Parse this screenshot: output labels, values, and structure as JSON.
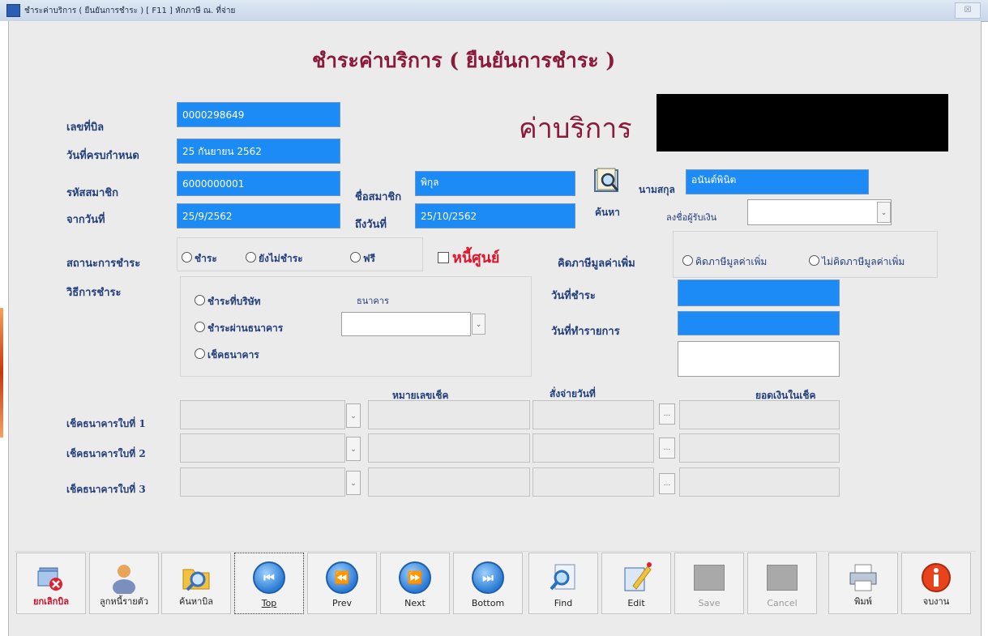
{
  "window": {
    "title": "ชำระค่าบริการ ( ยืนยันการชำระ ) [ F11 ] หักภาษี ณ. ที่จ่าย",
    "close_label": "☒"
  },
  "heading": "ชำระค่าบริการ ( ยืนยันการชำระ )",
  "service_title": "ค่าบริการ",
  "labels": {
    "bill_no": "เลขที่บิล",
    "due_date": "วันที่ครบกำหนด",
    "member_code": "รหัสสมาชิก",
    "from_date": "จากวันที่",
    "member_name": "ชื่อสมาชิก",
    "to_date": "ถึงวันที่",
    "surname": "นามสกุล",
    "search": "ค้นหา",
    "signer": "ลงชื่อผู้รับเงิน",
    "pay_status": "สถานะการชำระ",
    "vat": "คิดภาษีมูลค่าเพิ่ม",
    "pay_method": "วิธีการชำระ",
    "bank": "ธนาคาร",
    "pay_date": "วันที่ชำระ",
    "trans_date": "วันที่ทำรายการ",
    "cheque_no_header": "หมายเลขเช็ค",
    "pay_date_header": "สั่งจ่ายวันที่",
    "amount_header": "ยอดเงินในเช็ค",
    "zero_debt": "หนี้ศูนย์"
  },
  "fields": {
    "bill_no": "0000298649",
    "due_date": "25 กันยายน 2562",
    "member_code": "6000000001",
    "from_date": "25/9/2562",
    "member_name": "พิกุล",
    "to_date": "25/10/2562",
    "surname": "อนันต์พินิต"
  },
  "status_options": [
    "ชำระ",
    "ยังไม่ชำระ",
    "ฟรี"
  ],
  "vat_options": [
    "คิดภาษีมูลค่าเพิ่ม",
    "ไม่คิดภาษีมูลค่าเพิ่ม"
  ],
  "method_options": [
    "ชำระที่บริษัท",
    "ชำระผ่านธนาคาร",
    "เช็คธนาคาร"
  ],
  "cheque_rows": [
    "เช็คธนาคารใบที่ 1",
    "เช็คธนาคารใบที่ 2",
    "เช็คธนาคารใบที่ 3"
  ],
  "combo_arrow": "⌄",
  "dots": "...",
  "toolbar": {
    "cancel_bill": "ยกเลิกบิล",
    "debtor": "ลูกหนี้รายตัว",
    "search_bill": "ค้นหาบิล",
    "top": "Top",
    "prev": "Prev",
    "next": "Next",
    "bottom": "Bottom",
    "find": "Find",
    "edit": "Edit",
    "save": "Save",
    "cancel": "Cancel",
    "print": "พิมพ์",
    "exit": "จบงาน"
  },
  "icons": {
    "top": "⏮",
    "prev": "⏪",
    "next": "⏩",
    "bottom": "⏭"
  },
  "colors": {
    "field_blue": "#1c8bf5",
    "label_navy": "#233e7c",
    "heading_maroon": "#8b1a3a",
    "zero_debt_red": "#e0122a"
  }
}
